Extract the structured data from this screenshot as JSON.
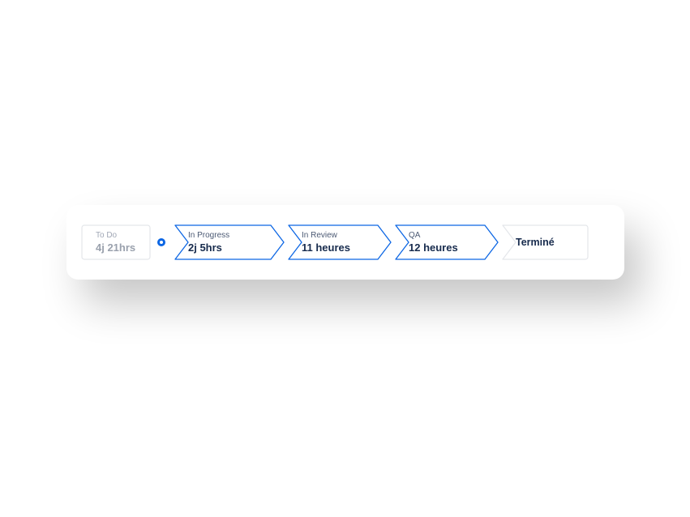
{
  "pipeline": {
    "stages": [
      {
        "id": "todo",
        "label": "To Do",
        "value": "4j 21hrs",
        "state": "muted"
      },
      {
        "id": "inprogress",
        "label": "In Progress",
        "value": "2j 5hrs",
        "state": "active"
      },
      {
        "id": "inreview",
        "label": "In Review",
        "value": "11 heures",
        "state": "active"
      },
      {
        "id": "qa",
        "label": "QA",
        "value": "12 heures",
        "state": "active"
      },
      {
        "id": "done",
        "label": "",
        "value": "Terminé",
        "state": "final"
      }
    ]
  },
  "colors": {
    "active_border": "#0C66E4",
    "muted_border": "#e4e6ea",
    "text_dark": "#172B4D",
    "text_muted": "#a0a7b5"
  }
}
